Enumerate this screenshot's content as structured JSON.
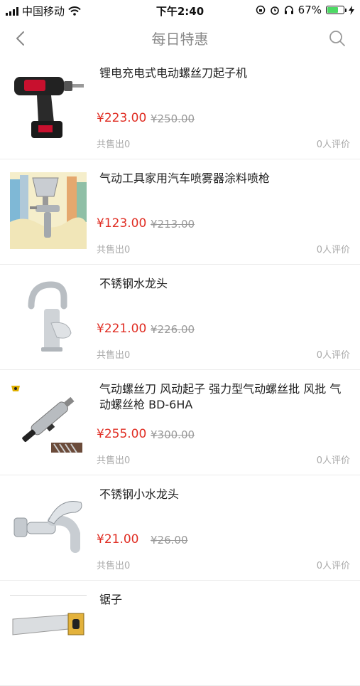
{
  "status_bar": {
    "carrier": "中国移动",
    "time": "下午2:40",
    "battery": "67%",
    "battery_level": 0.67
  },
  "nav": {
    "title": "每日特惠",
    "back_icon": "chevron-left-icon",
    "search_icon": "search-icon"
  },
  "products": [
    {
      "name": "锂电充电式电动螺丝刀起子机",
      "price": "¥223.00",
      "old_price": "¥250.00",
      "sold": "共售出0",
      "reviews": "0人评价"
    },
    {
      "name": "气动工具家用汽车喷雾器涂料喷枪",
      "price": "¥123.00",
      "old_price": "¥213.00",
      "sold": "共售出0",
      "reviews": "0人评价"
    },
    {
      "name": "不锈钢水龙头",
      "price": "¥221.00",
      "old_price": "¥226.00",
      "sold": "共售出0",
      "reviews": "0人评价"
    },
    {
      "name": "气动螺丝刀 风动起子 强力型气动螺丝批 风批 气动螺丝枪 BD-6HA",
      "price": "¥255.00",
      "old_price": "¥300.00",
      "sold": "共售出0",
      "reviews": "0人评价"
    },
    {
      "name": "不锈钢小水龙头",
      "price": "¥21.00",
      "old_price": "¥26.00",
      "sold": "共售出0",
      "reviews": "0人评价"
    },
    {
      "name": "锯子"
    }
  ]
}
